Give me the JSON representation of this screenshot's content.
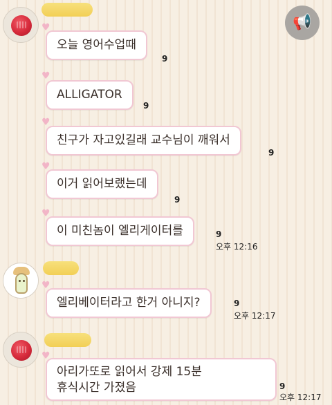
{
  "chat": {
    "icons": {
      "megaphone": "megaphone-icon",
      "bubble_tail": "heart-icon"
    },
    "messages": [
      {
        "text": "오늘 영어수업때",
        "unread": "9"
      },
      {
        "text": "ALLIGATOR",
        "unread": "9"
      },
      {
        "text": "친구가 자고있길래 교수님이 깨워서",
        "unread": "9"
      },
      {
        "text": "이거 읽어보랬는데",
        "unread": "9"
      },
      {
        "text": "이 미친놈이 엘리게이터를",
        "unread": "9",
        "time": "오후 12:16"
      },
      {
        "text": "엘리베이터라고 한거 아니지?",
        "unread": "9",
        "time": "오후 12:17"
      },
      {
        "lines": [
          "아리가또로 읽어서 강제 15분",
          "휴식시간 가졌음"
        ],
        "unread": "9",
        "time": "오후 12:17"
      }
    ]
  }
}
